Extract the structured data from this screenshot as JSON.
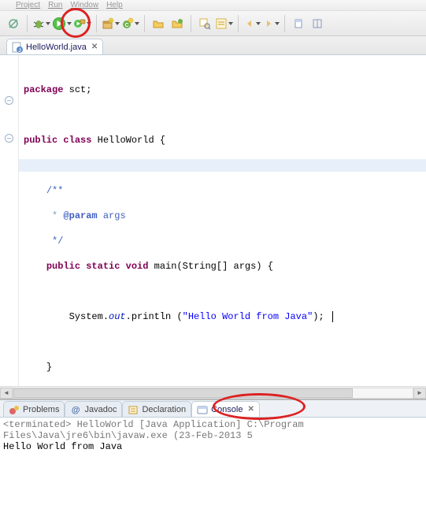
{
  "menubar": {
    "items": [
      "...",
      "Project",
      "Run",
      "Window",
      "Help"
    ]
  },
  "editor": {
    "tab_label": "HelloWorld.java",
    "code_package": "package",
    "code_pkgname": " sct;",
    "code_public": "public",
    "code_class": "class",
    "code_classname": " HelloWorld {",
    "code_javadoc1": "/**",
    "code_javadoc2_pre": " * ",
    "code_javadoc2_tag": "@param",
    "code_javadoc2_post": " args",
    "code_javadoc3": " */",
    "code_static": "static",
    "code_void": "void",
    "code_main_sig": " main(String[] args) {",
    "code_sys": "System.",
    "code_out": "out",
    "code_println": ".println (",
    "code_string": "\"Hello World from Java\"",
    "code_println_close": "); ",
    "code_brace_m": "}",
    "code_brace_c": "}"
  },
  "views": {
    "problems": "Problems",
    "javadoc": "Javadoc",
    "declaration": "Declaration",
    "console": "Console"
  },
  "console": {
    "status": "<terminated> HelloWorld [Java Application] C:\\Program Files\\Java\\jre6\\bin\\javaw.exe (23-Feb-2013 5",
    "output": "Hello World from Java"
  }
}
